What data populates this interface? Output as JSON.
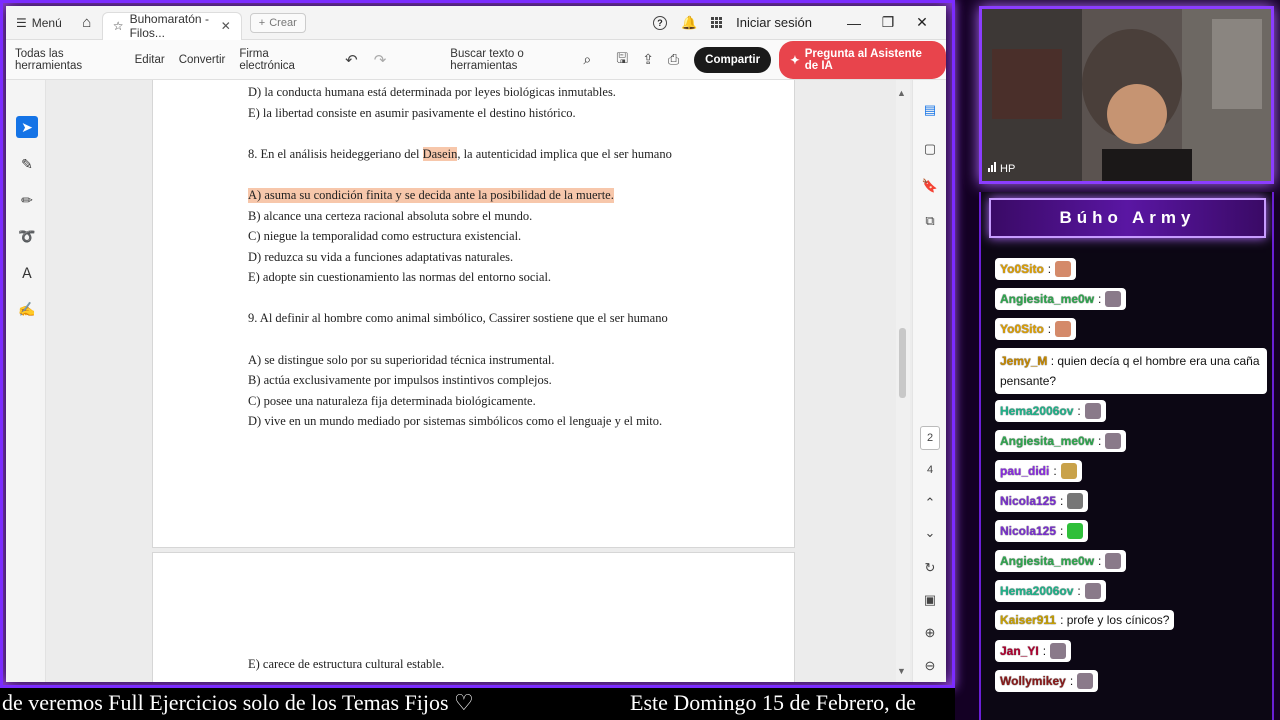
{
  "titlebar": {
    "menu_label": "Menú",
    "tab_title": "Buhomaratón - Filos...",
    "new_tab_label": "Crear",
    "signin_label": "Iniciar sesión"
  },
  "toolbar": {
    "items": [
      "Todas las herramientas",
      "Editar",
      "Convertir",
      "Firma electrónica"
    ],
    "search_label": "Buscar texto o herramientas",
    "share_label": "Compartir",
    "ai_label": "Pregunta al Asistente de IA"
  },
  "document": {
    "lines": [
      "D) la conducta humana está determinada por leyes biológicas inmutables.",
      "E) la libertad consiste en asumir pasivamente el destino histórico."
    ],
    "q8_prefix": "8. En el análisis heideggeriano del ",
    "q8_highlight": "Dasein",
    "q8_suffix": ", la autenticidad implica que el ser humano",
    "q8_answers": [
      "A) asuma su condición finita y se decida ante la posibilidad de la muerte.",
      "B) alcance una certeza racional absoluta sobre el mundo.",
      "C) niegue la temporalidad como estructura existencial.",
      "D) reduzca su vida a funciones adaptativas naturales.",
      "E) adopte sin cuestionamiento las normas del entorno social."
    ],
    "q9": "9. Al definir al hombre como animal simbólico, Cassirer sostiene que el ser humano",
    "q9_answers": [
      "A) se distingue solo por su superioridad técnica instrumental.",
      "B) actúa exclusivamente por impulsos instintivos complejos.",
      "C) posee una naturaleza fija determinada biológicamente.",
      "D) vive en un mundo mediado por sistemas simbólicos como el lenguaje y el mito."
    ],
    "page2_line": "E) carece de estructura cultural estable."
  },
  "pages": {
    "current": "2",
    "total": "4"
  },
  "ticker": {
    "left_text": "de veremos Full Ejercicios solo de los Temas Fijos ♡",
    "right_text": "Este Domingo 15 de Febrero, de"
  },
  "cam": {
    "label": "HP"
  },
  "chat": {
    "title": "Búho Army",
    "messages": [
      {
        "user": "Yo0Sito",
        "text": ":",
        "color": "#e0a100",
        "emote": "#d48a6a"
      },
      {
        "user": "Angiesita_me0w",
        "text": ":",
        "color": "#2fa84f",
        "emote": "#8a7a8a"
      },
      {
        "user": "Yo0Sito",
        "text": ":",
        "color": "#e0a100",
        "emote": "#d48a6a"
      },
      {
        "user": "Jemy_M",
        "text": ": quien decía q el hombre era una caña pensante?",
        "color": "#c78a00",
        "emote": ""
      },
      {
        "user": "Hema2006ov",
        "text": ":",
        "color": "#1fb38a",
        "emote": "#8a7a8a"
      },
      {
        "user": "Angiesita_me0w",
        "text": ":",
        "color": "#2fa84f",
        "emote": "#8a7a8a"
      },
      {
        "user": "pau_didi",
        "text": ":",
        "color": "#8a2be2",
        "emote": "#c9a24a"
      },
      {
        "user": "Nicola125",
        "text": ":",
        "color": "#7a2fd0",
        "emote": "#777777"
      },
      {
        "user": "Nicola125",
        "text": ":",
        "color": "#7a2fd0",
        "emote": "#2fbf3a"
      },
      {
        "user": "Angiesita_me0w",
        "text": ":",
        "color": "#2fa84f",
        "emote": "#8a7a8a"
      },
      {
        "user": "Hema2006ov",
        "text": ":",
        "color": "#1fb38a",
        "emote": "#8a7a8a"
      },
      {
        "user": "Kaiser911",
        "text": ": profe y los cínicos?",
        "color": "#c9a100",
        "emote": ""
      },
      {
        "user": "Jan_YI",
        "text": ":",
        "color": "#b00030",
        "emote": "#8a7a8a"
      },
      {
        "user": "Wollymikey",
        "text": ":",
        "color": "#8b1a1a",
        "emote": "#8a7a8a"
      }
    ]
  }
}
